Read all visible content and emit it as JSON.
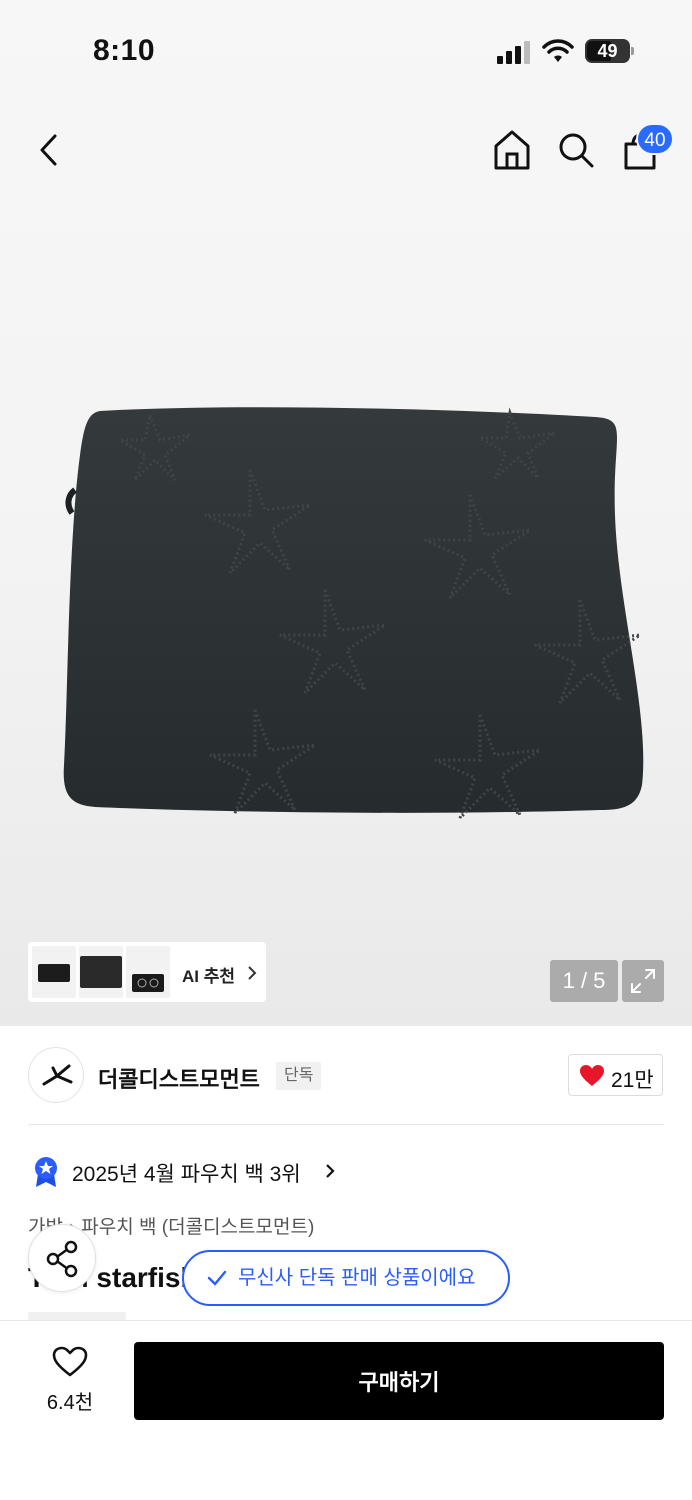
{
  "status_bar": {
    "time": "8:10",
    "battery": "49"
  },
  "nav": {
    "cart_count": "40"
  },
  "gallery": {
    "ai_label": "AI 추천",
    "counter": "1 / 5"
  },
  "brand": {
    "name": "더콜디스트모먼트",
    "tag": "단독",
    "likes": "21만"
  },
  "ranking": {
    "text": "2025년 4월 파우치 백 3위"
  },
  "breadcrumb": {
    "cat1": "가방",
    "cat2": "파우치 백 (더콜디스트모먼트)"
  },
  "product": {
    "title": "TCM starfish laptop case (charcoal)"
  },
  "toast": {
    "text": "무신사 단독 판매 상품이에요"
  },
  "bottom": {
    "wish_count": "6.4천",
    "buy_label": "구매하기"
  },
  "colors": {
    "accent": "#2a5cff",
    "heart": "#e8162b",
    "product": "#2c3133"
  }
}
